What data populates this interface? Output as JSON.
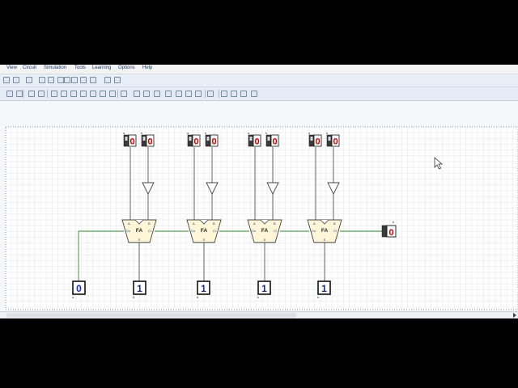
{
  "menu": {
    "items": [
      "View",
      "Circuit",
      "Simulation",
      "Tools",
      "Learning",
      "Options",
      "Help"
    ]
  },
  "toolbar": {
    "row1_icons": [
      "new-file-icon",
      "print-icon",
      "undo-icon",
      "cut-icon",
      "copy-icon",
      "paste-icon",
      "delete-icon",
      "zoom-in-icon",
      "zoom-out-icon",
      "hand-icon",
      "play-icon",
      "settings-icon"
    ],
    "row2_icons": [
      "select-icon",
      "wire-icon",
      "junction-icon",
      "pin-icon",
      "and-gate-icon",
      "or-gate-icon",
      "not-gate-icon",
      "nand-gate-icon",
      "nor-gate-icon",
      "xor-gate-icon",
      "xnor-gate-icon",
      "buffer-icon",
      "flipflop-icon",
      "register-icon",
      "counter-icon",
      "mux-icon",
      "decoder-icon",
      "adder-icon",
      "memory-icon",
      "display-icon",
      "label-icon",
      "clock-icon",
      "led-icon",
      "keyboard-icon"
    ]
  },
  "circuit": {
    "input_switches": [
      {
        "pin_a": "a",
        "a": "0",
        "pin_b": "b",
        "b": "0"
      },
      {
        "pin_a": "a",
        "a": "0",
        "pin_b": "b",
        "b": "0"
      },
      {
        "pin_a": "a",
        "a": "0",
        "pin_b": "b",
        "b": "0"
      },
      {
        "pin_a": "a",
        "a": "0",
        "pin_b": "b",
        "b": "0"
      }
    ],
    "full_adders": [
      {
        "name": "FA",
        "a": "A",
        "b": "B",
        "co": "Co",
        "ci": "Ci",
        "s": "S"
      },
      {
        "name": "FA",
        "a": "A",
        "b": "B",
        "co": "Co",
        "ci": "Ci",
        "s": "S"
      },
      {
        "name": "FA",
        "a": "A",
        "b": "B",
        "co": "Co",
        "ci": "Ci",
        "s": "S"
      },
      {
        "name": "FA",
        "a": "A",
        "b": "B",
        "co": "Co",
        "ci": "Ci",
        "s": "S"
      }
    ],
    "carry_in": {
      "value": "0",
      "pin": "a"
    },
    "carry_out": {
      "value": "0",
      "pin": "b"
    },
    "outputs": [
      {
        "value": "1",
        "pin": "b"
      },
      {
        "value": "1",
        "pin": "b"
      },
      {
        "value": "1",
        "pin": "b"
      },
      {
        "value": "1",
        "pin": "b"
      }
    ]
  },
  "colors": {
    "wire": "#555555",
    "carry_wire": "#2e8b2e",
    "input_digit": "#cc0000",
    "output_digit": "#1a2a8a",
    "display_bg": "#ffffff",
    "adder_fill": "#fff6d8",
    "grid": "#e2e4e8"
  }
}
